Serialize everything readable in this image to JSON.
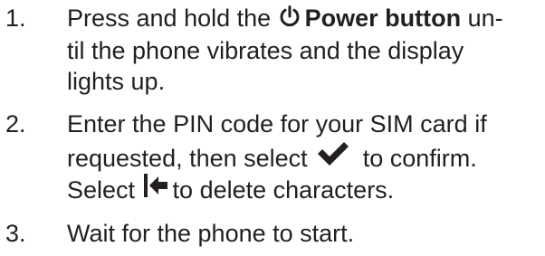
{
  "steps": [
    {
      "number": "1.",
      "lines": [
        [
          "Press and hold the ",
          "Power button",
          " un-"
        ],
        [
          "til the phone vibrates and the display"
        ],
        [
          "lights up."
        ]
      ],
      "icon": "power-icon"
    },
    {
      "number": "2.",
      "lines": [
        [
          "Enter the PIN code for your SIM card if"
        ],
        [
          "requested, then select ",
          " to confirm."
        ],
        [
          "Select ",
          "to delete characters."
        ]
      ],
      "icons": [
        "checkmark-icon",
        "backspace-icon"
      ]
    },
    {
      "number": "3.",
      "lines": [
        [
          "Wait for the phone to start."
        ]
      ]
    }
  ]
}
